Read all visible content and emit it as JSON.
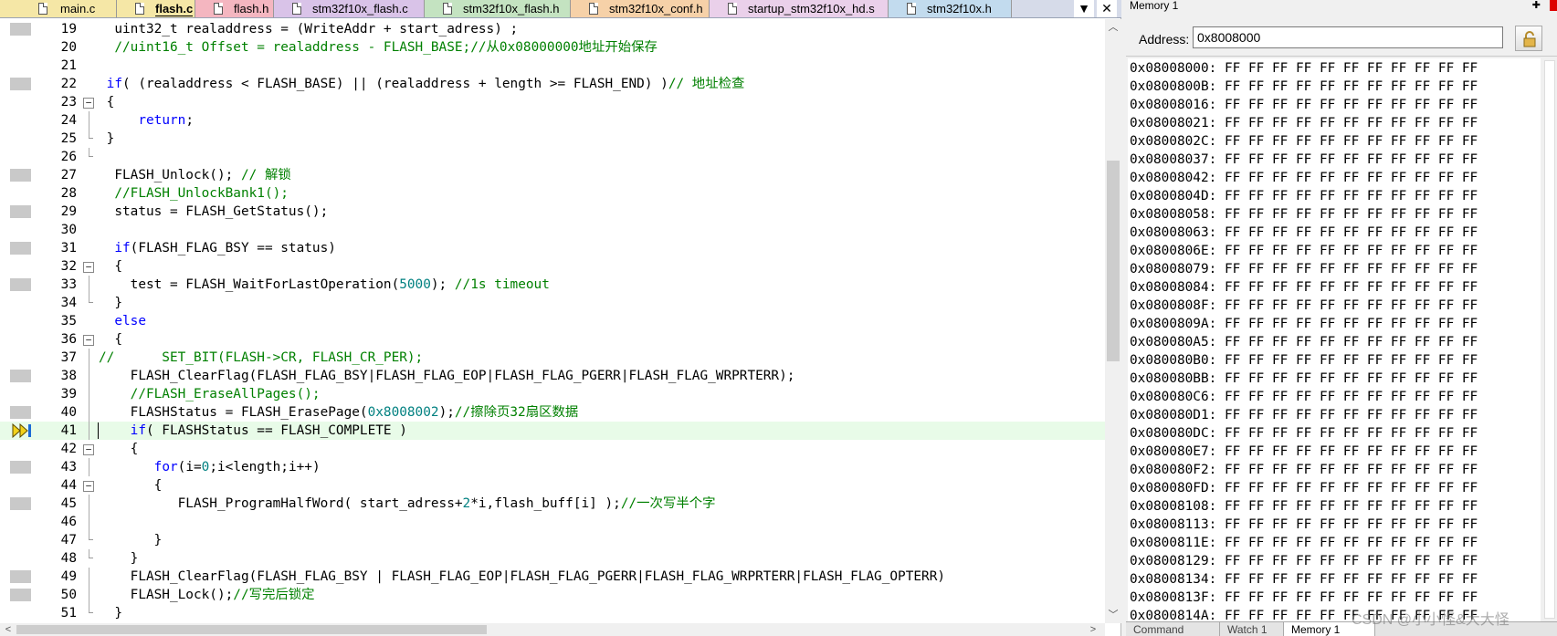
{
  "editor": {
    "tabs": [
      {
        "label": "main.c",
        "color": "#f5e7a6",
        "active": false
      },
      {
        "label": "flash.c",
        "color": "#f5e7a6",
        "active": true
      },
      {
        "label": "flash.h",
        "color": "#f4b6c0",
        "active": false
      },
      {
        "label": "stm32f10x_flash.c",
        "color": "#d9c3e8",
        "active": false
      },
      {
        "label": "stm32f10x_flash.h",
        "color": "#c4e3c1",
        "active": false
      },
      {
        "label": "stm32f10x_conf.h",
        "color": "#f6d1a8",
        "active": false
      },
      {
        "label": "startup_stm32f10x_hd.s",
        "color": "#ead0ea",
        "active": false
      },
      {
        "label": "stm32f10x.h",
        "color": "#c2dbee",
        "active": false
      }
    ],
    "tab_dropdown_label": "▼",
    "tab_close_label": "✕",
    "current_line": 41,
    "lines": [
      {
        "n": "19",
        "bp": true,
        "fold": "",
        "text": "  uint32_t realaddress = (WriteAddr + start_adress) ;"
      },
      {
        "n": "20",
        "bp": false,
        "fold": "",
        "text": "  //uint16_t Offset = realaddress - FLASH_BASE;//从0x08000000地址开始保存"
      },
      {
        "n": "21",
        "bp": false,
        "fold": "",
        "text": ""
      },
      {
        "n": "22",
        "bp": true,
        "fold": "",
        "text": " if( (realaddress < FLASH_BASE) || (realaddress + length >= FLASH_END) )// 地址检查"
      },
      {
        "n": "23",
        "bp": false,
        "fold": "open",
        "text": " {"
      },
      {
        "n": "24",
        "bp": false,
        "fold": "line",
        "text": "     return;"
      },
      {
        "n": "25",
        "bp": false,
        "fold": "end",
        "text": " }"
      },
      {
        "n": "26",
        "bp": false,
        "fold": "end",
        "text": ""
      },
      {
        "n": "27",
        "bp": true,
        "fold": "",
        "text": "  FLASH_Unlock(); // 解锁"
      },
      {
        "n": "28",
        "bp": false,
        "fold": "",
        "text": "  //FLASH_UnlockBank1();"
      },
      {
        "n": "29",
        "bp": true,
        "fold": "",
        "text": "  status = FLASH_GetStatus();"
      },
      {
        "n": "30",
        "bp": false,
        "fold": "",
        "text": ""
      },
      {
        "n": "31",
        "bp": true,
        "fold": "",
        "text": "  if(FLASH_FLAG_BSY == status)"
      },
      {
        "n": "32",
        "bp": false,
        "fold": "open",
        "text": "  {"
      },
      {
        "n": "33",
        "bp": true,
        "fold": "line",
        "text": "    test = FLASH_WaitForLastOperation(5000); //1s timeout"
      },
      {
        "n": "34",
        "bp": false,
        "fold": "end",
        "text": "  }"
      },
      {
        "n": "35",
        "bp": false,
        "fold": "",
        "text": "  else"
      },
      {
        "n": "36",
        "bp": false,
        "fold": "open",
        "text": "  {"
      },
      {
        "n": "37",
        "bp": false,
        "fold": "line",
        "text": "//      SET_BIT(FLASH->CR, FLASH_CR_PER);"
      },
      {
        "n": "38",
        "bp": true,
        "fold": "line",
        "text": "    FLASH_ClearFlag(FLASH_FLAG_BSY|FLASH_FLAG_EOP|FLASH_FLAG_PGERR|FLASH_FLAG_WRPRTERR);"
      },
      {
        "n": "39",
        "bp": false,
        "fold": "line",
        "text": "    //FLASH_EraseAllPages();"
      },
      {
        "n": "40",
        "bp": true,
        "fold": "line",
        "text": "    FLASHStatus = FLASH_ErasePage(0x8008002);//擦除页32扇区数据"
      },
      {
        "n": "41",
        "bp": false,
        "fold": "line",
        "text": "    if( FLASHStatus == FLASH_COMPLETE )"
      },
      {
        "n": "42",
        "bp": false,
        "fold": "open",
        "text": "    {"
      },
      {
        "n": "43",
        "bp": true,
        "fold": "line",
        "text": "       for(i=0;i<length;i++)"
      },
      {
        "n": "44",
        "bp": false,
        "fold": "open",
        "text": "       {"
      },
      {
        "n": "45",
        "bp": true,
        "fold": "line",
        "text": "          FLASH_ProgramHalfWord( start_adress+2*i,flash_buff[i] );//一次写半个字"
      },
      {
        "n": "46",
        "bp": false,
        "fold": "line",
        "text": ""
      },
      {
        "n": "47",
        "bp": false,
        "fold": "end",
        "text": "       }"
      },
      {
        "n": "48",
        "bp": false,
        "fold": "end",
        "text": "    }"
      },
      {
        "n": "49",
        "bp": true,
        "fold": "line",
        "text": "    FLASH_ClearFlag(FLASH_FLAG_BSY | FLASH_FLAG_EOP|FLASH_FLAG_PGERR|FLASH_FLAG_WRPRTERR|FLASH_FLAG_OPTERR)"
      },
      {
        "n": "50",
        "bp": true,
        "fold": "line",
        "text": "    FLASH_Lock();//写完后锁定"
      },
      {
        "n": "51",
        "bp": false,
        "fold": "end",
        "text": "  }"
      }
    ]
  },
  "memory": {
    "title": "Memory 1",
    "address_label": "Address:",
    "address_value": "0x8008000",
    "bytes": "FF FF FF FF FF FF FF FF FF FF FF",
    "rows": [
      "0x08008000:",
      "0x0800800B:",
      "0x08008016:",
      "0x08008021:",
      "0x0800802C:",
      "0x08008037:",
      "0x08008042:",
      "0x0800804D:",
      "0x08008058:",
      "0x08008063:",
      "0x0800806E:",
      "0x08008079:",
      "0x08008084:",
      "0x0800808F:",
      "0x0800809A:",
      "0x080080A5:",
      "0x080080B0:",
      "0x080080BB:",
      "0x080080C6:",
      "0x080080D1:",
      "0x080080DC:",
      "0x080080E7:",
      "0x080080F2:",
      "0x080080FD:",
      "0x08008108:",
      "0x08008113:",
      "0x0800811E:",
      "0x08008129:",
      "0x08008134:",
      "0x0800813F:",
      "0x0800814A:"
    ],
    "bottom_tabs": [
      {
        "label": "Command",
        "active": false
      },
      {
        "label": "Watch 1",
        "active": false
      },
      {
        "label": "Memory 1",
        "active": true
      }
    ]
  },
  "watermark": "CSDN @小小怪&大大怪"
}
